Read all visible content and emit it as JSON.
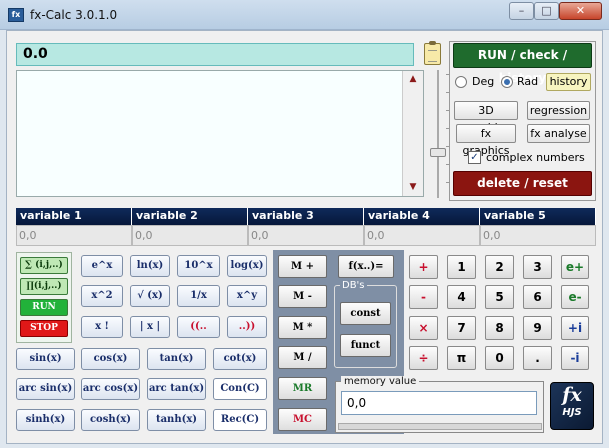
{
  "window": {
    "title": "fx-Calc 3.0.1.0",
    "min": "–",
    "max": "□",
    "close": "✕",
    "app_icon": "fx"
  },
  "display": {
    "value": "0.0"
  },
  "right": {
    "run_check": "RUN / check / history",
    "deg": "Deg",
    "rad": "Rad",
    "mode_selected": "Rad",
    "history": "history",
    "graphics3d": "3D graphics",
    "regression": "regression",
    "fx_graphics": "fx graphics",
    "fx_analyse": "fx analyse",
    "complex_numbers": "complex numbers",
    "complex_checked": true,
    "delete_reset": "delete / reset"
  },
  "variables": [
    {
      "name": "variable 1",
      "value": "0,0"
    },
    {
      "name": "variable 2",
      "value": "0,0"
    },
    {
      "name": "variable 3",
      "value": "0,0"
    },
    {
      "name": "variable 4",
      "value": "0,0"
    },
    {
      "name": "variable 5",
      "value": "0,0"
    }
  ],
  "sumblock": {
    "sum": "∑ (i,j,..)",
    "prod": "∏(i,j,..)",
    "run": "RUN",
    "stop": "STOP"
  },
  "functions": {
    "r1": [
      "e^x",
      "ln(x)",
      "10^x",
      "log(x)"
    ],
    "r2": [
      "x^2",
      "√ (x)",
      "1/x",
      "x^y"
    ],
    "r3": [
      "x !",
      "| x |",
      "((..",
      "..))"
    ],
    "r4": [
      "sin(x)",
      "cos(x)",
      "tan(x)",
      "cot(x)"
    ],
    "r5": [
      "arc sin(x)",
      "arc cos(x)",
      "arc tan(x)",
      "Con(C)"
    ],
    "r6": [
      "sinh(x)",
      "cosh(x)",
      "tanh(x)",
      "Rec(C)"
    ]
  },
  "memory": {
    "mplus": "M +",
    "mminus": "M -",
    "mtimes": "M *",
    "mdiv": "M /",
    "mr": "MR",
    "mc": "MC",
    "fx": "f(x..)=",
    "db_label": "DB's",
    "const": "const",
    "funct": "funct",
    "value_label": "memory value",
    "value": "0,0"
  },
  "pad": {
    "ops": [
      "+",
      "-",
      "×",
      "÷"
    ],
    "r1": [
      "1",
      "2",
      "3"
    ],
    "r2": [
      "4",
      "5",
      "6"
    ],
    "r3": [
      "7",
      "8",
      "9"
    ],
    "r4": [
      "π",
      "0",
      "."
    ],
    "side": [
      "e+",
      "e-",
      "+i",
      "-i"
    ]
  },
  "logo": {
    "fx": "fx",
    "sub": "HJS"
  },
  "colors": {
    "run": "#1f6b2d",
    "reset": "#8b1510",
    "display": "#b7e8e2",
    "var_header": "#0f2a5a"
  }
}
